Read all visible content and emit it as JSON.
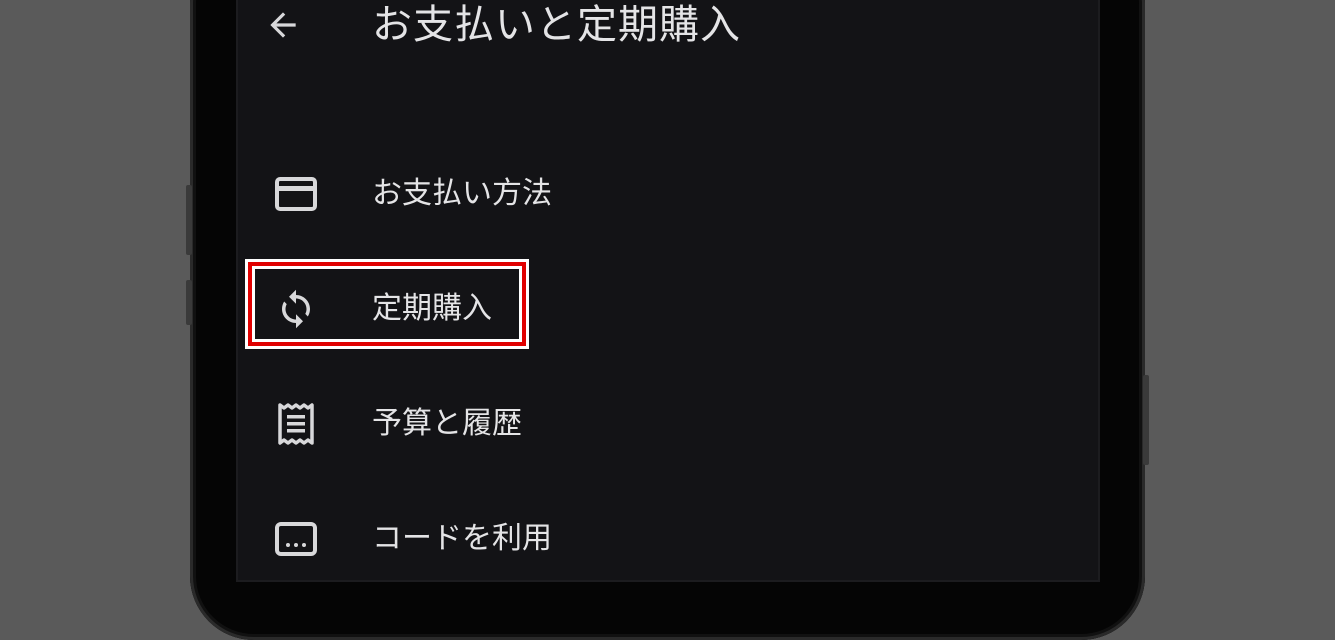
{
  "header": {
    "title": "お支払いと定期購入",
    "back_icon": "arrow-left-icon"
  },
  "menu": {
    "items": [
      {
        "label": "お支払い方法",
        "icon": "credit-card-icon"
      },
      {
        "label": "定期購入",
        "icon": "sync-icon",
        "highlighted": true
      },
      {
        "label": "予算と履歴",
        "icon": "receipt-icon"
      },
      {
        "label": "コードを利用",
        "icon": "redeem-code-icon"
      }
    ]
  },
  "colors": {
    "highlight": "#e00000",
    "text": "#e4e4e6",
    "screen_bg": "#131316"
  }
}
